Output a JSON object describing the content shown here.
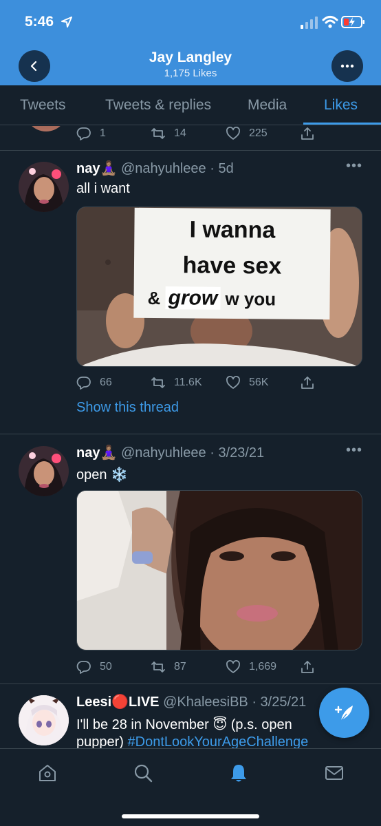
{
  "status_bar": {
    "time": "5:46"
  },
  "header": {
    "title": "Jay Langley",
    "subtitle": "1,175 Likes"
  },
  "tabs": [
    {
      "label": "Tweets"
    },
    {
      "label": "Tweets & replies"
    },
    {
      "label": "Media"
    },
    {
      "label": "Likes",
      "active": true
    }
  ],
  "partial_tweet": {
    "replies": "1",
    "retweets": "14",
    "likes": "225"
  },
  "tweets": [
    {
      "name": "nay🧘🏽‍♀️",
      "handle": "@nahyuhleee · 5d",
      "text": "all i want",
      "image": {
        "sign_lines": [
          "I wanna",
          "have sex",
          "&",
          "grow",
          "w you"
        ]
      },
      "replies": "66",
      "retweets": "11.6K",
      "likes": "56K",
      "show_thread": "Show this thread"
    },
    {
      "name": "nay🧘🏽‍♀️",
      "handle": "@nahyuhleee · 3/23/21",
      "text": "open ❄️",
      "replies": "50",
      "retweets": "87",
      "likes": "1,669"
    },
    {
      "name": "Leesi🔴LIVE",
      "handle": "@KhaleesiBB · 3/25/21",
      "text_line1": "I'll be 28 in November 😇  (p.s. open",
      "text_line2_prefix": "pupper) ",
      "hashtag": "#DontLookYourAgeChallenge"
    }
  ],
  "colors": {
    "accent": "#3d9be9",
    "header_bg": "#3d8fdc",
    "background": "#15202b",
    "secondary_text": "#8899a6"
  },
  "bottom_nav": [
    {
      "icon": "home-icon"
    },
    {
      "icon": "search-icon"
    },
    {
      "icon": "bell-icon",
      "active": true
    },
    {
      "icon": "mail-icon"
    }
  ]
}
